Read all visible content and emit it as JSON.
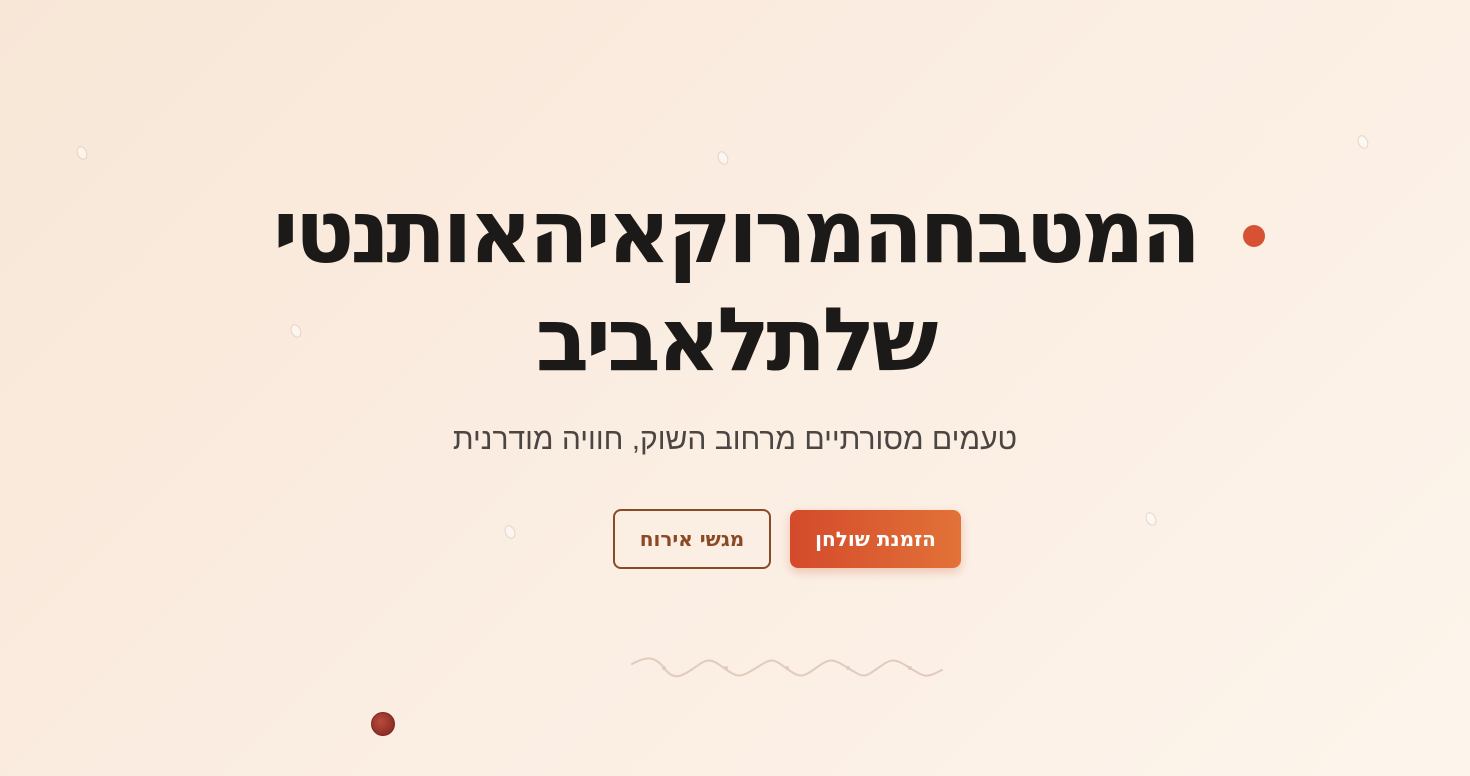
{
  "hero": {
    "title_line1": "המטבחהמרוקאיהאותנטי",
    "title_line2": "שלתלאביב",
    "subtitle": "טעמים מסורתיים מרחוב השוק, חוויה מודרנית",
    "primary_button": "הזמנת שולחן",
    "secondary_button": "מגשי אירוח"
  },
  "colors": {
    "accent": "#d65233",
    "secondary_button_border": "#8a4a26",
    "title_text": "#1c1a19",
    "background": "#f8e7d7"
  },
  "icons": {
    "accent_dot": "dot-icon",
    "wave_divider": "wave-divider-icon",
    "floating_badge": "decorative-badge-icon"
  }
}
